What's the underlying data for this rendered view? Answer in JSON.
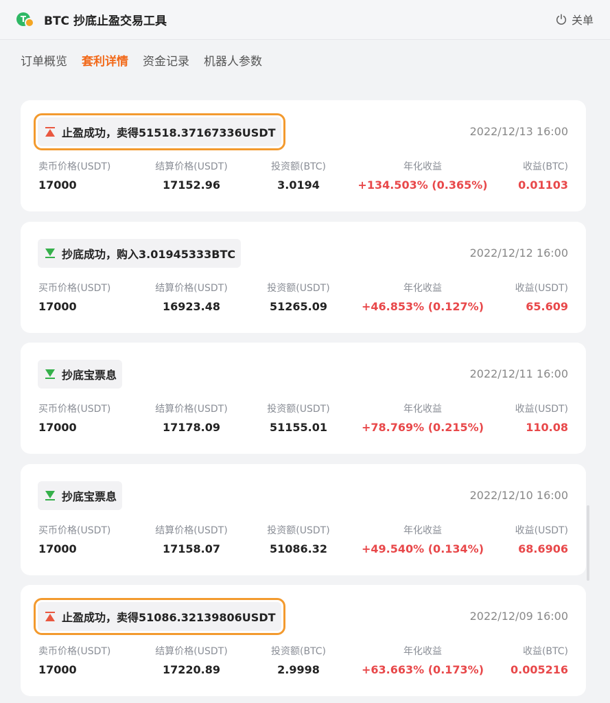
{
  "header": {
    "title": "BTC 抄底止盈交易工具",
    "close_label": "关单",
    "colors": {
      "logo_green": "#2fb865",
      "logo_orange": "#f4a623"
    }
  },
  "tabs": [
    {
      "label": "订单概览",
      "active": false
    },
    {
      "label": "套利详情",
      "active": true
    },
    {
      "label": "资金记录",
      "active": false
    },
    {
      "label": "机器人参数",
      "active": false
    }
  ],
  "colors": {
    "accent": "#f26a1b",
    "profit_red": "#e8484a",
    "highlight_outline": "#f39a2e"
  },
  "records": [
    {
      "type": "take-profit",
      "icon": "take-profit-triangle-up-icon",
      "title": "止盈成功，卖得51518.37167336USDT",
      "highlighted": true,
      "date": "2022/12/13 16:00",
      "labels": [
        "卖币价格(USDT)",
        "结算价格(USDT)",
        "投资额(BTC)",
        "年化收益",
        "收益(BTC)"
      ],
      "values": [
        "17000",
        "17152.96",
        "3.0194",
        "+134.503% (0.365%)",
        "0.01103"
      ]
    },
    {
      "type": "buy-dip",
      "icon": "buy-dip-triangle-down-icon",
      "title": "抄底成功，购入3.01945333BTC",
      "highlighted": false,
      "date": "2022/12/12 16:00",
      "labels": [
        "买币价格(USDT)",
        "结算价格(USDT)",
        "投资额(USDT)",
        "年化收益",
        "收益(USDT)"
      ],
      "values": [
        "17000",
        "16923.48",
        "51265.09",
        "+46.853% (0.127%)",
        "65.609"
      ]
    },
    {
      "type": "interest",
      "icon": "buy-dip-triangle-down-icon",
      "title": "抄底宝票息",
      "highlighted": false,
      "date": "2022/12/11 16:00",
      "labels": [
        "买币价格(USDT)",
        "结算价格(USDT)",
        "投资额(USDT)",
        "年化收益",
        "收益(USDT)"
      ],
      "values": [
        "17000",
        "17178.09",
        "51155.01",
        "+78.769% (0.215%)",
        "110.08"
      ]
    },
    {
      "type": "interest",
      "icon": "buy-dip-triangle-down-icon",
      "title": "抄底宝票息",
      "highlighted": false,
      "date": "2022/12/10 16:00",
      "labels": [
        "买币价格(USDT)",
        "结算价格(USDT)",
        "投资额(USDT)",
        "年化收益",
        "收益(USDT)"
      ],
      "values": [
        "17000",
        "17158.07",
        "51086.32",
        "+49.540% (0.134%)",
        "68.6906"
      ]
    },
    {
      "type": "take-profit",
      "icon": "take-profit-triangle-up-icon",
      "title": "止盈成功，卖得51086.32139806USDT",
      "highlighted": true,
      "date": "2022/12/09 16:00",
      "labels": [
        "卖币价格(USDT)",
        "结算价格(USDT)",
        "投资额(BTC)",
        "年化收益",
        "收益(BTC)"
      ],
      "values": [
        "17000",
        "17220.89",
        "2.9998",
        "+63.663% (0.173%)",
        "0.005216"
      ]
    }
  ]
}
